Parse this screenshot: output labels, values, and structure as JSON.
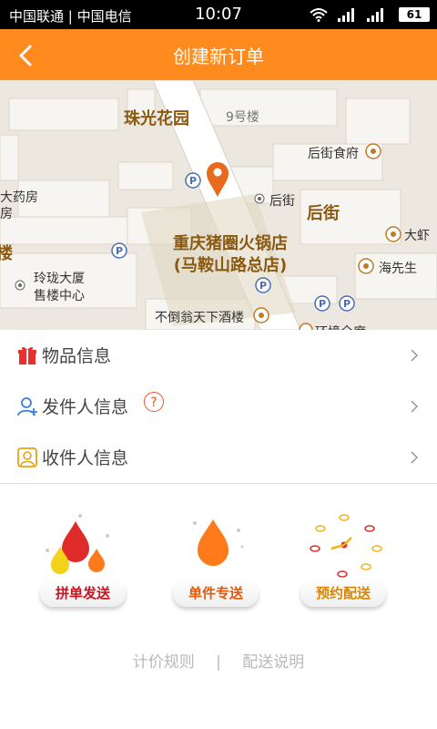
{
  "status_bar": {
    "carriers": "中国联通 | 中国电信",
    "time": "10:07",
    "battery": "61"
  },
  "header": {
    "title": "创建新订单"
  },
  "map": {
    "labels": {
      "park": "珠光花园",
      "building9": "9号楼",
      "canteen": "后街食府",
      "pharmacy": "大药房",
      "houjie_small": "后街",
      "houjie_big": "后街",
      "restaurant_line1": "重庆猪圈火锅店",
      "restaurant_line2": "(马鞍山路总店)",
      "dashrimp": "大虾",
      "mr_hai": "海先生",
      "linglong_line1": "玲珑大厦",
      "linglong_line2": "售楼中心",
      "budaoweng": "不倒翁天下酒楼",
      "cut_bottom": "环境全席",
      "cut_left1": "楼",
      "cut_left2": "房"
    }
  },
  "rows": [
    {
      "label": "物品信息",
      "icon": "gift-icon"
    },
    {
      "label": "发件人信息",
      "icon": "add-user-icon"
    },
    {
      "label": "收件人信息",
      "icon": "contact-icon"
    }
  ],
  "services": [
    {
      "label": "拼单发送",
      "color": "#e02b2b"
    },
    {
      "label": "单件专送",
      "color": "#ff7a1a"
    },
    {
      "label": "预约配送",
      "color": "#e89100"
    }
  ],
  "footer": {
    "pricing_rules": "计价规则",
    "separator": "|",
    "delivery_info": "配送说明"
  },
  "colors": {
    "accent": "#ff8a1e"
  }
}
